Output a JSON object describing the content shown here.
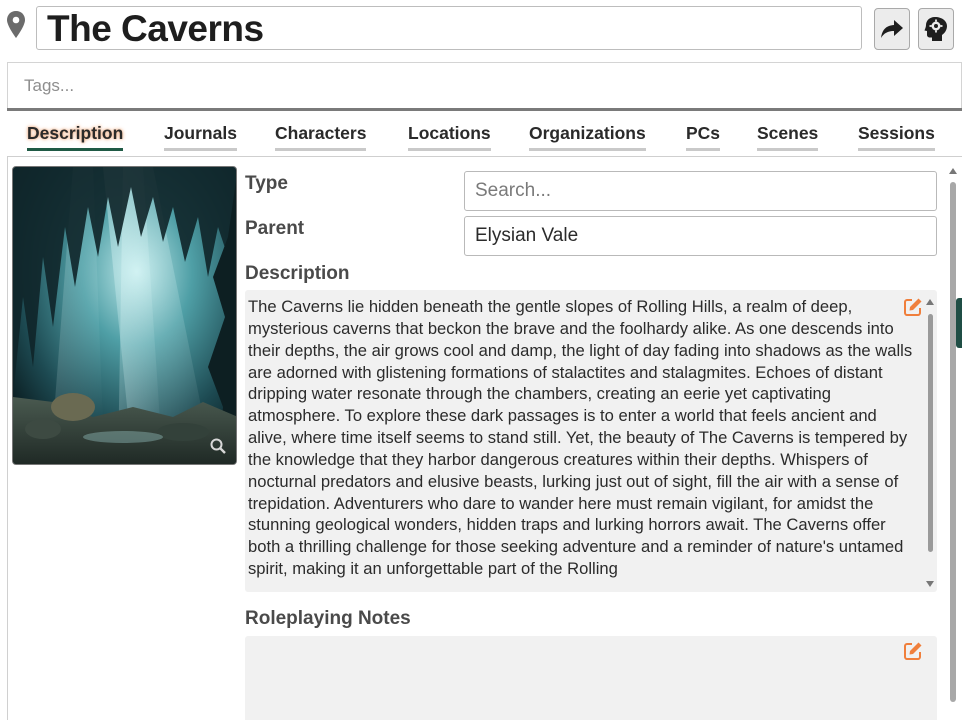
{
  "header": {
    "title": "The Caverns",
    "tags_placeholder": "Tags..."
  },
  "tabs": [
    {
      "label": "Description",
      "active": true
    },
    {
      "label": "Journals",
      "active": false
    },
    {
      "label": "Characters",
      "active": false
    },
    {
      "label": "Locations",
      "active": false
    },
    {
      "label": "Organizations",
      "active": false
    },
    {
      "label": "PCs",
      "active": false
    },
    {
      "label": "Scenes",
      "active": false
    },
    {
      "label": "Sessions",
      "active": false
    }
  ],
  "fields": {
    "type_label": "Type",
    "type_placeholder": "Search...",
    "parent_label": "Parent",
    "parent_value": "Elysian Vale",
    "description_label": "Description",
    "description_text": "The Caverns lie hidden beneath the gentle slopes of Rolling Hills, a realm of deep, mysterious caverns that beckon the brave and the foolhardy alike. As one descends into their depths, the air grows cool and damp, the light of day fading into shadows as the walls are adorned with glistening formations of stalactites and stalagmites. Echoes of distant dripping water resonate through the chambers, creating an eerie yet captivating atmosphere. To explore these dark passages is to enter a world that feels ancient and alive, where time itself seems to stand still. Yet, the beauty of The Caverns is tempered by the knowledge that they harbor dangerous creatures within their depths. Whispers of nocturnal predators and elusive beasts, lurking just out of sight, fill the air with a sense of trepidation. Adventurers who dare to wander here must remain vigilant, for amidst the stunning geological wonders, hidden traps and lurking horrors await. The Caverns offer both a thrilling challenge for those seeking adventure and a reminder of nature's untamed spirit, making it an unforgettable part of the Rolling",
    "roleplaying_label": "Roleplaying Notes"
  },
  "colors": {
    "accent": "#1f5a45",
    "edit_icon": "#f07f3c",
    "field_bg": "#f1f1f1"
  },
  "icons": [
    "map-pin-icon",
    "share-icon",
    "brain-gear-icon",
    "zoom-icon",
    "edit-icon"
  ]
}
